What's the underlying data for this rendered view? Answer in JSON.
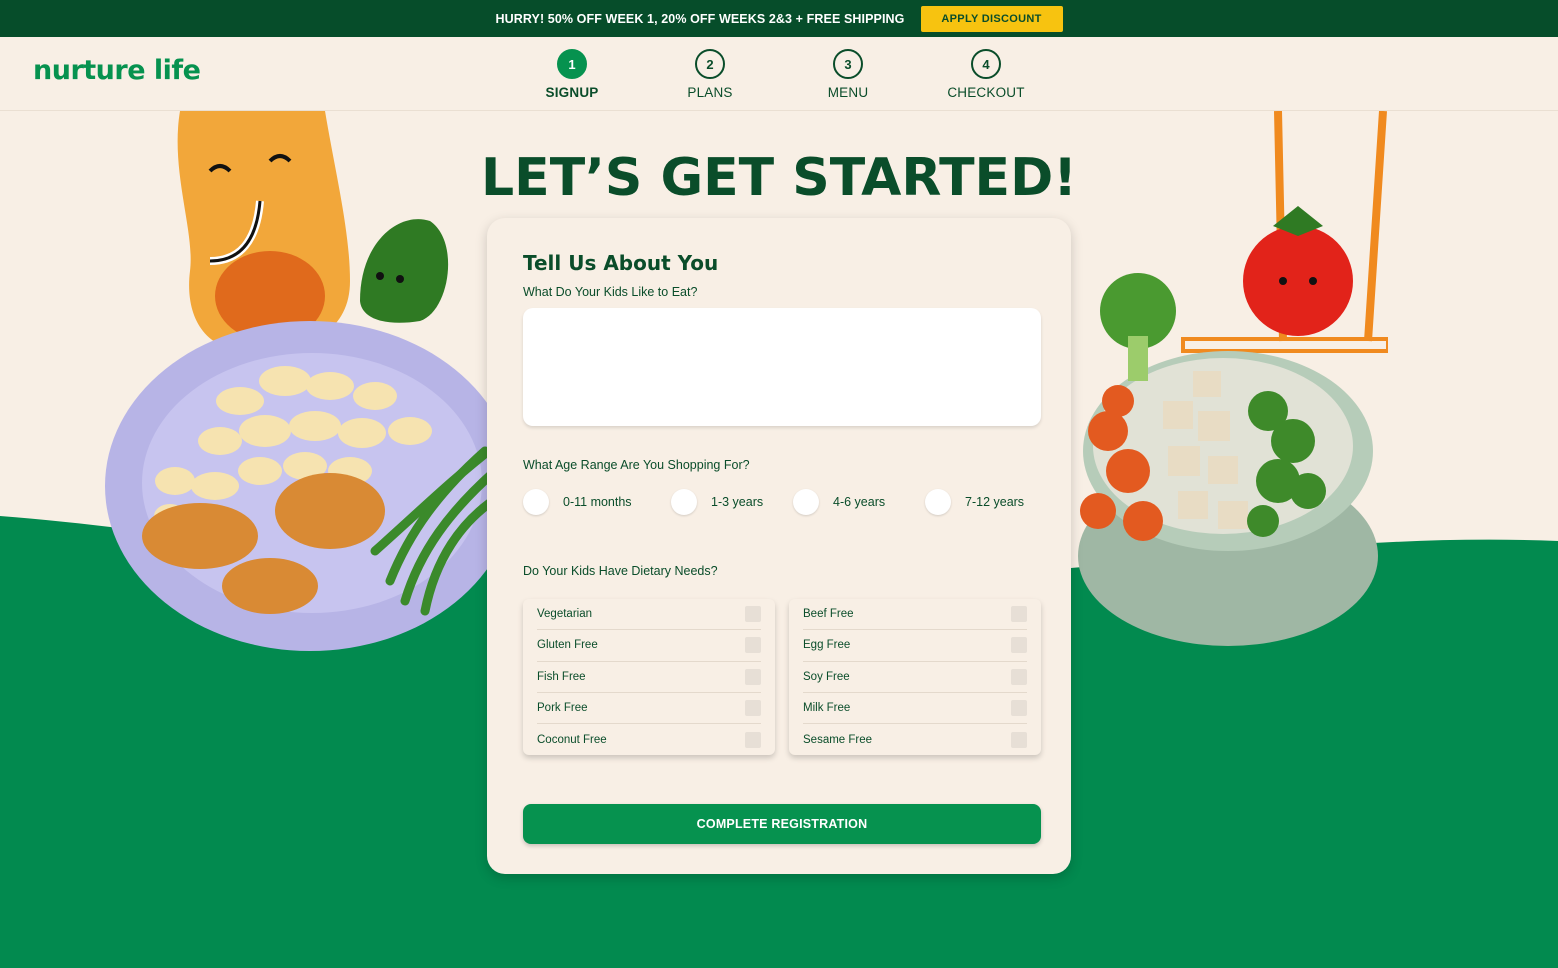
{
  "promo": {
    "text": "HURRY! 50% OFF WEEK 1, 20% OFF WEEKS 2&3 + FREE SHIPPING",
    "button": "APPLY DISCOUNT"
  },
  "header": {
    "logo": "nurture life",
    "steps": [
      {
        "number": "1",
        "label": "SIGNUP",
        "active": true
      },
      {
        "number": "2",
        "label": "PLANS",
        "active": false
      },
      {
        "number": "3",
        "label": "MENU",
        "active": false
      },
      {
        "number": "4",
        "label": "CHECKOUT",
        "active": false
      }
    ]
  },
  "title": "LET’S GET STARTED!",
  "form": {
    "heading": "Tell Us About You",
    "kids_eat_label": "What Do Your Kids Like to Eat?",
    "kids_eat_value": "",
    "age_label": "What Age Range Are You Shopping For?",
    "ages": [
      "0-11 months",
      "1-3 years",
      "4-6 years",
      "7-12 years"
    ],
    "diet_label": "Do Your Kids Have Dietary Needs?",
    "diet_left": [
      "Vegetarian",
      "Gluten Free",
      "Fish Free",
      "Pork Free",
      "Coconut Free"
    ],
    "diet_right": [
      "Beef Free",
      "Egg Free",
      "Soy Free",
      "Milk Free",
      "Sesame Free"
    ],
    "submit": "COMPLETE REGISTRATION"
  },
  "colors": {
    "dark_green": "#0a4d2a",
    "brand_green": "#06924f",
    "cream": "#f8efe5",
    "yellow": "#f7c310"
  }
}
